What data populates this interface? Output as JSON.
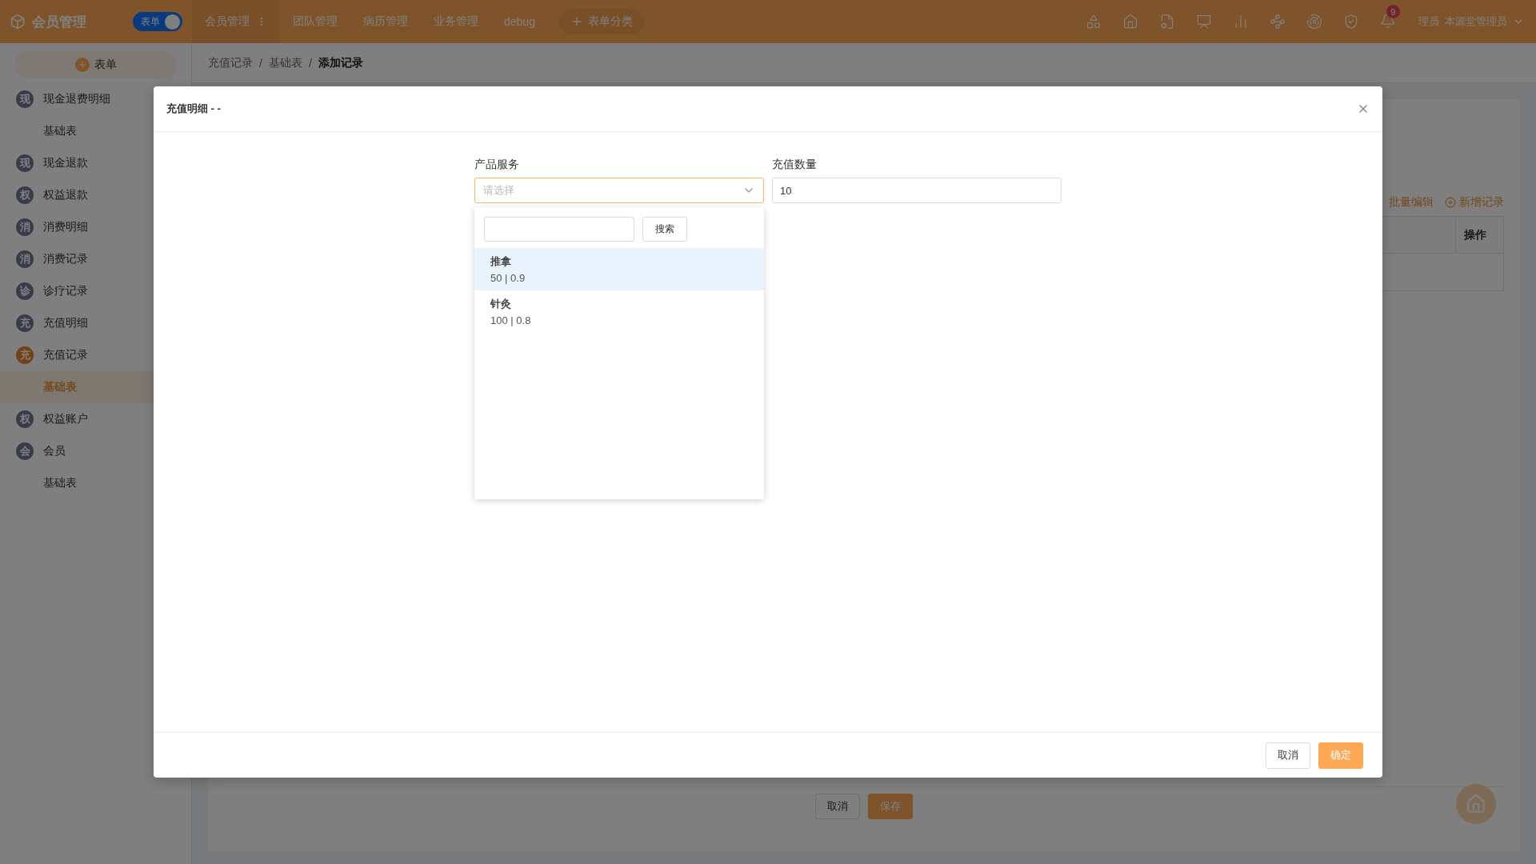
{
  "app": {
    "title": "会员管理",
    "mode_toggle": {
      "label": "表单",
      "on": true
    }
  },
  "nav": [
    {
      "label": "会员管理",
      "selected": true
    },
    {
      "label": "团队管理",
      "selected": false
    },
    {
      "label": "病历管理",
      "selected": false
    },
    {
      "label": "业务管理",
      "selected": false
    },
    {
      "label": "debug",
      "selected": false
    }
  ],
  "add_category": "表单分类",
  "notifications": "9",
  "user": "理员  本源堂管理员",
  "sidebar": {
    "add_button": "表单",
    "items": [
      {
        "badge": "现",
        "label": "现金退费明细",
        "active": false,
        "children": [
          {
            "label": "基础表",
            "selected": false
          }
        ]
      },
      {
        "badge": "现",
        "label": "现金退款",
        "active": false
      },
      {
        "badge": "权",
        "label": "权益退款",
        "active": false
      },
      {
        "badge": "消",
        "label": "消费明细",
        "active": false
      },
      {
        "badge": "消",
        "label": "消费记录",
        "active": false
      },
      {
        "badge": "诊",
        "label": "诊疗记录",
        "active": false
      },
      {
        "badge": "充",
        "label": "充值明细",
        "active": false
      },
      {
        "badge": "充",
        "label": "充值记录",
        "active": true,
        "children": [
          {
            "label": "基础表",
            "selected": true
          }
        ]
      },
      {
        "badge": "权",
        "label": "权益账户",
        "active": false
      },
      {
        "badge": "会",
        "label": "会员",
        "active": false,
        "children": [
          {
            "label": "基础表",
            "selected": false
          }
        ]
      }
    ]
  },
  "breadcrumb": [
    "充值记录",
    "基础表",
    "添加记录"
  ],
  "breadcrumb_separator": "/",
  "table_toolbar": {
    "batch_edit": "批量编辑",
    "add_record": "新增记录"
  },
  "table": {
    "columns": [
      "操作"
    ]
  },
  "form_buttons": [
    "取消",
    "保存"
  ],
  "dialog": {
    "title": "充值明细 - -",
    "fields": [
      {
        "label": "产品服务",
        "kind": "select",
        "placeholder": "请选择"
      },
      {
        "label": "充值数量",
        "kind": "input",
        "value": "10"
      }
    ],
    "dropdown": {
      "search_button": "搜索",
      "options": [
        {
          "name": "推拿",
          "detail": "50 | 0.9",
          "selected": true
        },
        {
          "name": "针灸",
          "detail": "100 | 0.8",
          "selected": false
        }
      ]
    },
    "buttons": [
      "取消",
      "确定"
    ]
  }
}
